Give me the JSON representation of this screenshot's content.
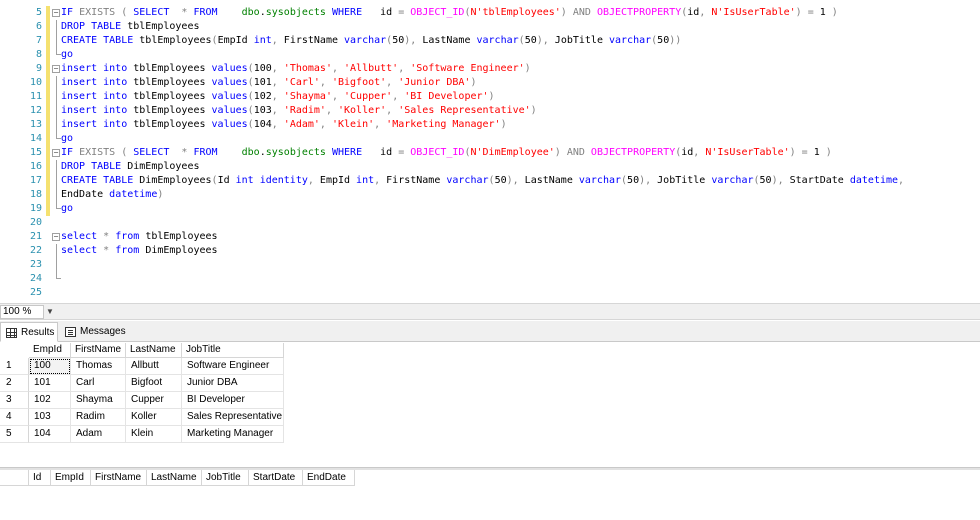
{
  "editor": {
    "lines": [
      {
        "num": "5",
        "mod": true,
        "fold": "open",
        "tokens": [
          [
            "kw",
            "IF "
          ],
          [
            "op",
            "EXISTS ( "
          ],
          [
            "kw",
            "SELECT "
          ],
          [
            "op",
            " * "
          ],
          [
            "kw",
            "FROM "
          ],
          [
            "id",
            "   "
          ],
          [
            "sys",
            "dbo"
          ],
          [
            "id",
            "."
          ],
          [
            "sys",
            "sysobjects"
          ],
          [
            "id",
            " "
          ],
          [
            "kw",
            "WHERE "
          ],
          [
            "id",
            "  id "
          ],
          [
            "op",
            "= "
          ],
          [
            "fn",
            "OBJECT_ID"
          ],
          [
            "op",
            "("
          ],
          [
            "str",
            "N'tblEmployees'"
          ],
          [
            "op",
            ") "
          ],
          [
            "op",
            "AND "
          ],
          [
            "fn",
            "OBJECTPROPERTY"
          ],
          [
            "op",
            "("
          ],
          [
            "id",
            "id"
          ],
          [
            "op",
            ", "
          ],
          [
            "str",
            "N'IsUserTable'"
          ],
          [
            "op",
            ") = "
          ],
          [
            "id",
            "1 "
          ],
          [
            "op",
            ")"
          ]
        ]
      },
      {
        "num": "6",
        "mod": true,
        "fold": "line",
        "tokens": [
          [
            "kw",
            "DROP TABLE "
          ],
          [
            "id",
            "tblEmployees"
          ]
        ]
      },
      {
        "num": "7",
        "mod": true,
        "fold": "line",
        "tokens": [
          [
            "kw",
            "CREATE TABLE "
          ],
          [
            "id",
            "tblEmployees"
          ],
          [
            "op",
            "("
          ],
          [
            "id",
            "EmpId "
          ],
          [
            "kw",
            "int"
          ],
          [
            "op",
            ", "
          ],
          [
            "id",
            "FirstName "
          ],
          [
            "kw",
            "varchar"
          ],
          [
            "op",
            "("
          ],
          [
            "id",
            "50"
          ],
          [
            "op",
            "), "
          ],
          [
            "id",
            "LastName "
          ],
          [
            "kw",
            "varchar"
          ],
          [
            "op",
            "("
          ],
          [
            "id",
            "50"
          ],
          [
            "op",
            "), "
          ],
          [
            "id",
            "JobTitle "
          ],
          [
            "kw",
            "varchar"
          ],
          [
            "op",
            "("
          ],
          [
            "id",
            "50"
          ],
          [
            "op",
            "))"
          ]
        ]
      },
      {
        "num": "8",
        "mod": true,
        "fold": "end",
        "tokens": [
          [
            "kw",
            "go"
          ]
        ]
      },
      {
        "num": "9",
        "mod": true,
        "fold": "open",
        "tokens": [
          [
            "kw",
            "insert into "
          ],
          [
            "id",
            "tblEmployees "
          ],
          [
            "kw",
            "values"
          ],
          [
            "op",
            "("
          ],
          [
            "id",
            "100"
          ],
          [
            "op",
            ", "
          ],
          [
            "str",
            "'Thomas'"
          ],
          [
            "op",
            ", "
          ],
          [
            "str",
            "'Allbutt'"
          ],
          [
            "op",
            ", "
          ],
          [
            "str",
            "'Software Engineer'"
          ],
          [
            "op",
            ")"
          ]
        ]
      },
      {
        "num": "10",
        "mod": true,
        "fold": "line",
        "tokens": [
          [
            "kw",
            "insert into "
          ],
          [
            "id",
            "tblEmployees "
          ],
          [
            "kw",
            "values"
          ],
          [
            "op",
            "("
          ],
          [
            "id",
            "101"
          ],
          [
            "op",
            ", "
          ],
          [
            "str",
            "'Carl'"
          ],
          [
            "op",
            ", "
          ],
          [
            "str",
            "'Bigfoot'"
          ],
          [
            "op",
            ", "
          ],
          [
            "str",
            "'Junior DBA'"
          ],
          [
            "op",
            ")"
          ]
        ]
      },
      {
        "num": "11",
        "mod": true,
        "fold": "line",
        "tokens": [
          [
            "kw",
            "insert into "
          ],
          [
            "id",
            "tblEmployees "
          ],
          [
            "kw",
            "values"
          ],
          [
            "op",
            "("
          ],
          [
            "id",
            "102"
          ],
          [
            "op",
            ", "
          ],
          [
            "str",
            "'Shayma'"
          ],
          [
            "op",
            ", "
          ],
          [
            "str",
            "'Cupper'"
          ],
          [
            "op",
            ", "
          ],
          [
            "str",
            "'BI Developer'"
          ],
          [
            "op",
            ")"
          ]
        ]
      },
      {
        "num": "12",
        "mod": true,
        "fold": "line",
        "tokens": [
          [
            "kw",
            "insert into "
          ],
          [
            "id",
            "tblEmployees "
          ],
          [
            "kw",
            "values"
          ],
          [
            "op",
            "("
          ],
          [
            "id",
            "103"
          ],
          [
            "op",
            ", "
          ],
          [
            "str",
            "'Radim'"
          ],
          [
            "op",
            ", "
          ],
          [
            "str",
            "'Koller'"
          ],
          [
            "op",
            ", "
          ],
          [
            "str",
            "'Sales Representative'"
          ],
          [
            "op",
            ")"
          ]
        ]
      },
      {
        "num": "13",
        "mod": true,
        "fold": "line",
        "tokens": [
          [
            "kw",
            "insert into "
          ],
          [
            "id",
            "tblEmployees "
          ],
          [
            "kw",
            "values"
          ],
          [
            "op",
            "("
          ],
          [
            "id",
            "104"
          ],
          [
            "op",
            ", "
          ],
          [
            "str",
            "'Adam'"
          ],
          [
            "op",
            ", "
          ],
          [
            "str",
            "'Klein'"
          ],
          [
            "op",
            ", "
          ],
          [
            "str",
            "'Marketing Manager'"
          ],
          [
            "op",
            ")"
          ]
        ]
      },
      {
        "num": "14",
        "mod": true,
        "fold": "end",
        "tokens": [
          [
            "kw",
            "go"
          ]
        ]
      },
      {
        "num": "15",
        "mod": true,
        "fold": "open",
        "tokens": [
          [
            "kw",
            "IF "
          ],
          [
            "op",
            "EXISTS ( "
          ],
          [
            "kw",
            "SELECT "
          ],
          [
            "op",
            " * "
          ],
          [
            "kw",
            "FROM "
          ],
          [
            "id",
            "   "
          ],
          [
            "sys",
            "dbo"
          ],
          [
            "id",
            "."
          ],
          [
            "sys",
            "sysobjects"
          ],
          [
            "id",
            " "
          ],
          [
            "kw",
            "WHERE "
          ],
          [
            "id",
            "  id "
          ],
          [
            "op",
            "= "
          ],
          [
            "fn",
            "OBJECT_ID"
          ],
          [
            "op",
            "("
          ],
          [
            "str",
            "N'DimEmployee'"
          ],
          [
            "op",
            ") "
          ],
          [
            "op",
            "AND "
          ],
          [
            "fn",
            "OBJECTPROPERTY"
          ],
          [
            "op",
            "("
          ],
          [
            "id",
            "id"
          ],
          [
            "op",
            ", "
          ],
          [
            "str",
            "N'IsUserTable'"
          ],
          [
            "op",
            ") = "
          ],
          [
            "id",
            "1 "
          ],
          [
            "op",
            ")"
          ]
        ]
      },
      {
        "num": "16",
        "mod": true,
        "fold": "line",
        "tokens": [
          [
            "kw",
            "DROP TABLE "
          ],
          [
            "id",
            "DimEmployees"
          ]
        ]
      },
      {
        "num": "17",
        "mod": true,
        "fold": "line",
        "tokens": [
          [
            "kw",
            "CREATE TABLE "
          ],
          [
            "id",
            "DimEmployees"
          ],
          [
            "op",
            "("
          ],
          [
            "id",
            "Id "
          ],
          [
            "kw",
            "int identity"
          ],
          [
            "op",
            ", "
          ],
          [
            "id",
            "EmpId "
          ],
          [
            "kw",
            "int"
          ],
          [
            "op",
            ", "
          ],
          [
            "id",
            "FirstName "
          ],
          [
            "kw",
            "varchar"
          ],
          [
            "op",
            "("
          ],
          [
            "id",
            "50"
          ],
          [
            "op",
            "), "
          ],
          [
            "id",
            "LastName "
          ],
          [
            "kw",
            "varchar"
          ],
          [
            "op",
            "("
          ],
          [
            "id",
            "50"
          ],
          [
            "op",
            "), "
          ],
          [
            "id",
            "JobTitle "
          ],
          [
            "kw",
            "varchar"
          ],
          [
            "op",
            "("
          ],
          [
            "id",
            "50"
          ],
          [
            "op",
            "), "
          ],
          [
            "id",
            "StartDate "
          ],
          [
            "kw",
            "datetime"
          ],
          [
            "op",
            ","
          ]
        ]
      },
      {
        "num": "18",
        "mod": true,
        "fold": "line",
        "tokens": [
          [
            "id",
            "EndDate "
          ],
          [
            "kw",
            "datetime"
          ],
          [
            "op",
            ")"
          ]
        ]
      },
      {
        "num": "19",
        "mod": true,
        "fold": "end",
        "tokens": [
          [
            "kw",
            "go"
          ]
        ]
      },
      {
        "num": "20",
        "mod": false,
        "fold": "none",
        "tokens": []
      },
      {
        "num": "21",
        "mod": false,
        "fold": "open",
        "tokens": [
          [
            "kw",
            "select "
          ],
          [
            "op",
            "* "
          ],
          [
            "kw",
            "from "
          ],
          [
            "id",
            "tblEmployees"
          ]
        ]
      },
      {
        "num": "22",
        "mod": false,
        "fold": "line",
        "tokens": [
          [
            "kw",
            "select "
          ],
          [
            "op",
            "* "
          ],
          [
            "kw",
            "from "
          ],
          [
            "id",
            "DimEmployees"
          ]
        ]
      },
      {
        "num": "23",
        "mod": false,
        "fold": "line",
        "tokens": []
      },
      {
        "num": "24",
        "mod": false,
        "fold": "end",
        "tokens": []
      },
      {
        "num": "25",
        "mod": false,
        "fold": "none",
        "tokens": []
      }
    ]
  },
  "zoom": {
    "value": "100 %"
  },
  "tabs": {
    "results": "Results",
    "messages": "Messages"
  },
  "grid1": {
    "columns": [
      "EmpId",
      "FirstName",
      "LastName",
      "JobTitle"
    ],
    "rows": [
      {
        "num": "1",
        "cells": [
          "100",
          "Thomas",
          "Allbutt",
          "Software Engineer"
        ]
      },
      {
        "num": "2",
        "cells": [
          "101",
          "Carl",
          "Bigfoot",
          "Junior DBA"
        ]
      },
      {
        "num": "3",
        "cells": [
          "102",
          "Shayma",
          "Cupper",
          "BI Developer"
        ]
      },
      {
        "num": "4",
        "cells": [
          "103",
          "Radim",
          "Koller",
          "Sales Representative"
        ]
      },
      {
        "num": "5",
        "cells": [
          "104",
          "Adam",
          "Klein",
          "Marketing Manager"
        ]
      }
    ]
  },
  "grid2": {
    "columns": [
      "Id",
      "EmpId",
      "FirstName",
      "LastName",
      "JobTitle",
      "StartDate",
      "EndDate"
    ]
  },
  "colors": {
    "keyword": "#0000ff",
    "function": "#ff00ff",
    "string": "#ff0000",
    "system": "#008000",
    "operator": "#808080",
    "line_number": "#2b91af",
    "change_marker": "#f5e170"
  }
}
